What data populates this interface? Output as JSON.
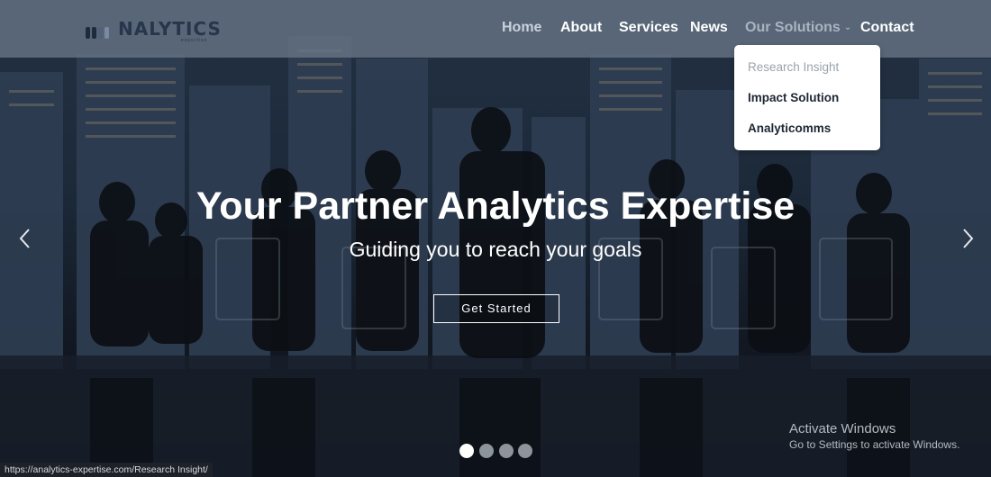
{
  "brand": {
    "logo_text": "NALYTICS",
    "logo_subtext": "expertise"
  },
  "nav": {
    "items": [
      {
        "label": "Home"
      },
      {
        "label": "About"
      },
      {
        "label": "Services"
      },
      {
        "label": "News"
      },
      {
        "label": "Our Solutions"
      },
      {
        "label": "Contact"
      }
    ]
  },
  "dropdown": {
    "items": [
      {
        "label": "Research Insight"
      },
      {
        "label": "Impact Solution"
      },
      {
        "label": "Analyticomms"
      }
    ]
  },
  "hero": {
    "title": "Your Partner Analytics Expertise",
    "subtitle": "Guiding you to reach your goals",
    "cta_label": "Get Started"
  },
  "carousel": {
    "slide_count": 4,
    "active_slide": 1,
    "prev_icon": "chevron-left-icon",
    "next_icon": "chevron-right-icon"
  },
  "watermark": {
    "title": "Activate Windows",
    "subtitle": "Go to Settings to activate Windows."
  },
  "status_bar": {
    "url": "https://analytics-expertise.com/Research Insight/"
  },
  "colors": {
    "header_bg": "#687686",
    "text_primary": "#ffffff",
    "dropdown_text": "#1d2733",
    "dropdown_muted": "#9aa3ad"
  }
}
